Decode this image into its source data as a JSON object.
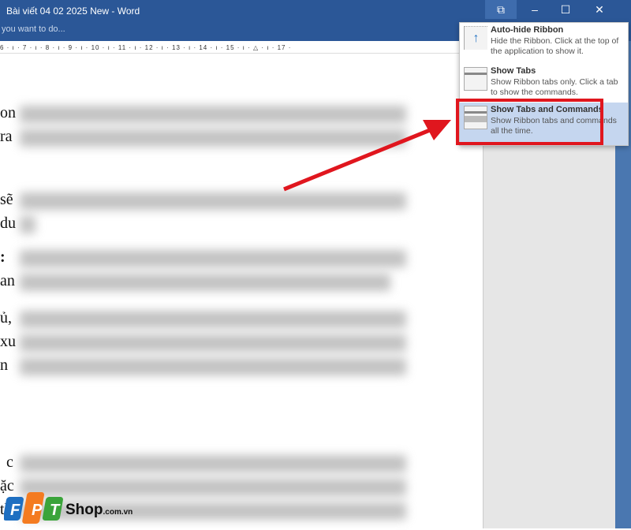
{
  "window": {
    "title": "Bài viết 04 02 2025 New - Word",
    "tell_me": "you want to do...",
    "buttons": {
      "ribbon_options": "⧉",
      "minimize": "–",
      "maximize": "☐",
      "close": "✕"
    }
  },
  "ruler": {
    "ticks": "6 · ı · 7 · ı · 8 · ı · 9 · ı · 10 · ı · 11 · ı · 12 · ı · 13 · ı · 14 · ı · 15 · ı · △ · ı · 17 ·"
  },
  "document": {
    "fragments": [
      "on",
      "ra",
      "sẽ",
      "du",
      ": ",
      "an",
      "ủ,",
      "xu",
      "n",
      "c",
      "ặc",
      "th"
    ]
  },
  "ribbon_menu": {
    "items": [
      {
        "title": "Auto-hide Ribbon",
        "desc": "Hide the Ribbon. Click at the top of the application to show it."
      },
      {
        "title": "Show Tabs",
        "desc": "Show Ribbon tabs only. Click a tab to show the commands."
      },
      {
        "title": "Show Tabs and Commands",
        "desc": "Show Ribbon tabs and commands all the time.",
        "selected": true
      }
    ]
  },
  "watermark": {
    "brand": "FPT",
    "shop": "Shop",
    "domain": ".com.vn"
  },
  "colors": {
    "titlebar": "#2b5797",
    "highlight": "#e0161e",
    "selected": "#c5d6ef"
  }
}
